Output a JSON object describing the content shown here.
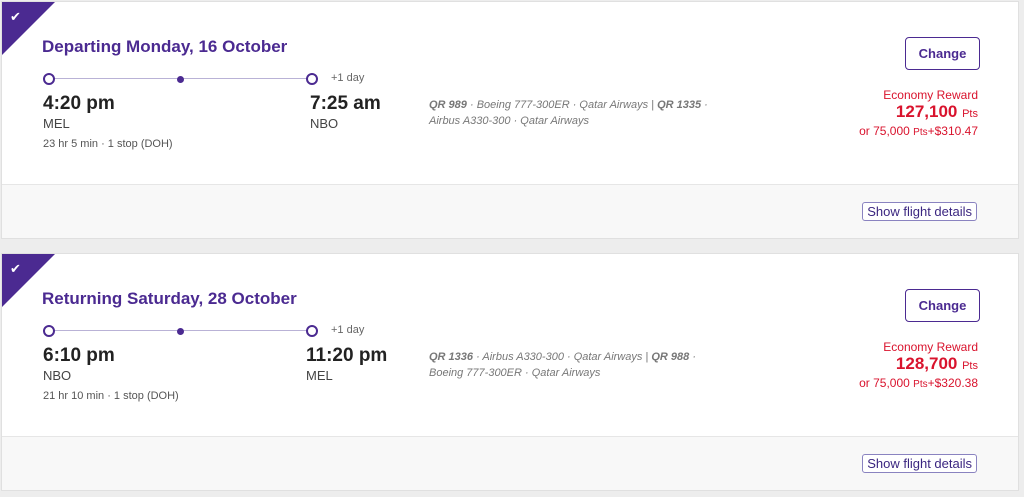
{
  "colors": {
    "accent": "#4b2a91",
    "price": "#d9132d",
    "background": "#ededed"
  },
  "legs": [
    {
      "heading": "Departing Monday, 16 October",
      "depart_time": "4:20 pm",
      "depart_code": "MEL",
      "arrive_time": "7:25 am",
      "arrive_code": "NBO",
      "day_offset": "+1 day",
      "duration": "23 hr 5 min · 1 stop (DOH)",
      "flight_line1_code": "QR 989",
      "flight_line1_text": " · Boeing 777-300ER · Qatar Airways | ",
      "flight_line1_code2": "QR 1335",
      "flight_line1_text2": " ·",
      "flight_line2_text": "Airbus A330-300 · Qatar Airways",
      "change_label": "Change",
      "reward_type": "Economy Reward",
      "points": "127,100",
      "points_unit": "Pts",
      "alt_prefix": "or 75,000 ",
      "alt_unit": "Pts",
      "alt_cash": "+$310.47",
      "details_label": "Show flight details",
      "selected_icon": "check-icon"
    },
    {
      "heading": "Returning Saturday, 28 October",
      "depart_time": "6:10 pm",
      "depart_code": "NBO",
      "arrive_time": "11:20 pm",
      "arrive_code": "MEL",
      "day_offset": "+1 day",
      "duration": "21 hr 10 min · 1 stop (DOH)",
      "flight_line1_code": "QR 1336",
      "flight_line1_text": " · Airbus A330-300 · Qatar Airways | ",
      "flight_line1_code2": "QR 988",
      "flight_line1_text2": " ·",
      "flight_line2_text": "Boeing 777-300ER · Qatar Airways",
      "change_label": "Change",
      "reward_type": "Economy Reward",
      "points": "128,700",
      "points_unit": "Pts",
      "alt_prefix": "or 75,000 ",
      "alt_unit": "Pts",
      "alt_cash": "+$320.38",
      "details_label": "Show flight details",
      "selected_icon": "check-icon"
    }
  ]
}
